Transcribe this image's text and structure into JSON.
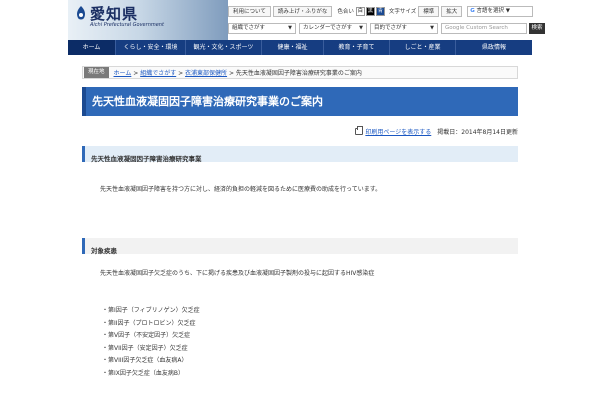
{
  "header": {
    "logo_text": "愛知県",
    "logo_sub": "Aichi Prefectural Government",
    "util": {
      "about": "利用について",
      "read_aloud": "読み上げ・ふりがな",
      "color": "色合い",
      "text_size_label": "文字サイズ",
      "size_normal": "標準",
      "size_large": "拡大",
      "google_select": "言語を選択"
    },
    "search": {
      "keyword_select": "組織でさがす",
      "calendar_select": "カレンダーでさがす",
      "purpose_select": "目的でさがす",
      "input_placeholder": "Google Custom Search",
      "submit": "検索"
    }
  },
  "nav": [
    "ホーム",
    "くらし・安全・環境",
    "観光・文化・スポーツ",
    "健康・福祉",
    "教育・子育て",
    "しごと・産業",
    "県政情報"
  ],
  "breadcrumb": {
    "here": "現在地",
    "items": [
      "ホーム",
      "組織でさがす",
      "衣浦東部保健所",
      "先天性血液凝固因子障害治療研究事業のご案内"
    ]
  },
  "page_title": "先天性血液凝固因子障害治療研究事業のご案内",
  "meta": {
    "print_link": "印刷用ページを表示する",
    "published": "掲載日：2014年8月14日更新"
  },
  "section1": {
    "heading": "先天性血液凝固因子障害治療研究事業",
    "text": "先天性血液凝固因子障害を持つ方に対し、経済的負担の軽減を図るために医療費の助成を行っています。"
  },
  "section2": {
    "heading": "対象疾患",
    "text": "先天性血液凝固因子欠乏症のうち、下に掲げる疾患及び血液凝固因子製剤の投与に起因するHIV感染症",
    "items": [
      "・第I因子（フィブリノゲン）欠乏症",
      "・第II因子（プロトロビン）欠乏症",
      "・第V因子（不安定因子）欠乏症",
      "・第VII因子（安定因子）欠乏症",
      "・第VIII因子欠乏症（血友病A）",
      "・第IX因子欠乏症（血友病B）"
    ]
  }
}
